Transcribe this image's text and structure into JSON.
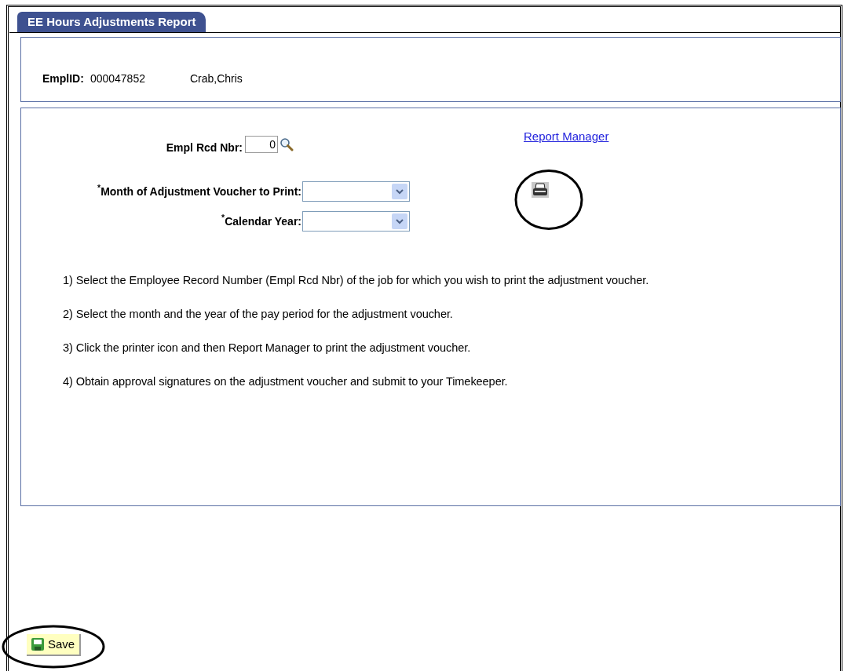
{
  "tab": {
    "label": "EE Hours Adjustments Report",
    "selected": true
  },
  "employee": {
    "label": "EmplID:",
    "id": "000047852",
    "name": "Crab,Chris"
  },
  "empl_rcd": {
    "label": "Empl Rcd Nbr:",
    "value": "0"
  },
  "report_manager_link": "Report Manager",
  "dropdowns": [
    {
      "label": "$^{*}$Month of Adjustment Voucher to Print:"
    },
    {
      "label": "$^{*}$Calendar Year:"
    }
  ],
  "instructions": [
    "1) Select the Employee Record Number (Empl Rcd Nbr) of the job for which you wish to print the adjustment voucher.",
    "2) Select the month and the year of the pay period for the adjustment voucher.",
    "3) Click the printer icon and then Report Manager to print the adjustment voucher.",
    "4) Obtain approval signatures on the adjustment voucher and submit to your Timekeeper."
  ],
  "save_button": "Save"
}
